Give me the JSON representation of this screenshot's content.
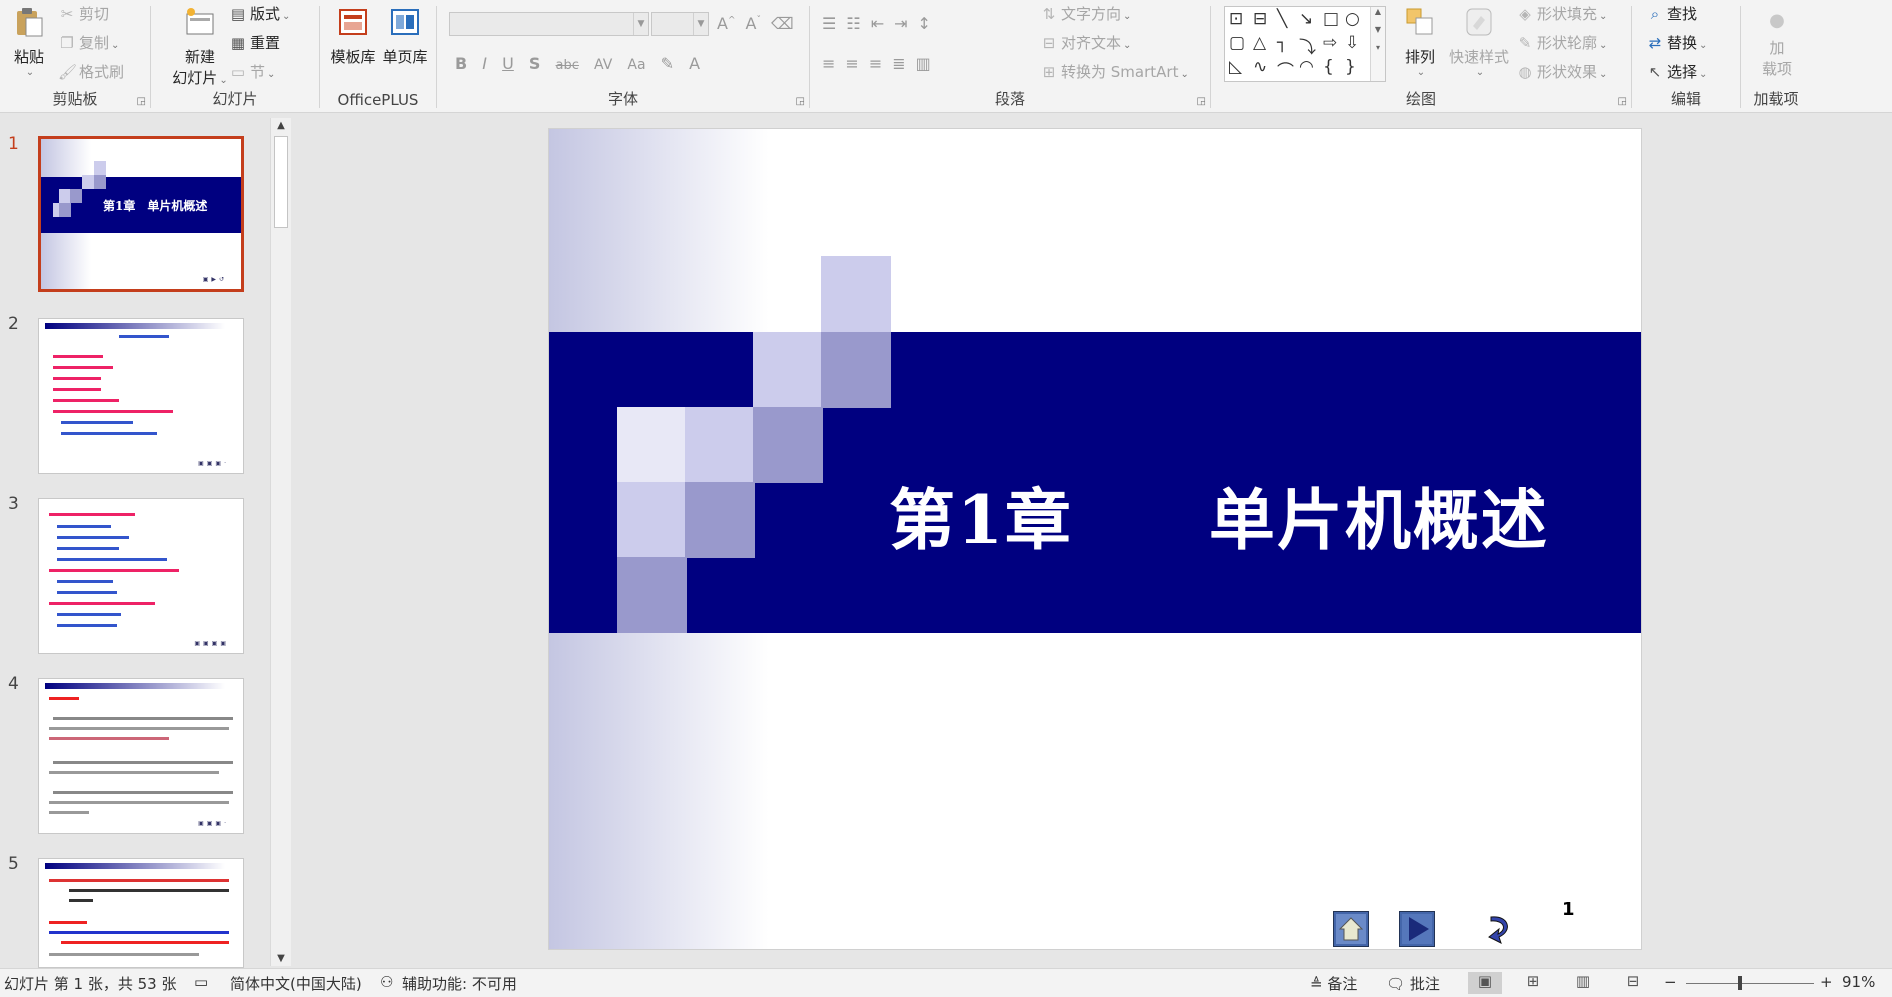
{
  "ribbon": {
    "clipboard": {
      "label": "剪贴板",
      "paste": "粘贴",
      "cut": "剪切",
      "copy": "复制",
      "format_painter": "格式刷"
    },
    "slides": {
      "label": "幻灯片",
      "new_slide": "新建\n幻灯片",
      "new_slide_line1": "新建",
      "new_slide_line2": "幻灯片",
      "layout": "版式",
      "reset": "重置",
      "section": "节"
    },
    "officeplus": {
      "label": "OfficePLUS",
      "template_library": "模板库",
      "single_page_library": "单页库"
    },
    "font": {
      "label": "字体",
      "font_name_value": "",
      "font_size_value": "",
      "bold": "B",
      "italic": "I",
      "underline": "U",
      "shadow": "S",
      "strike": "abc",
      "spacing": "AV",
      "case": "Aa"
    },
    "paragraph": {
      "label": "段落",
      "text_direction": "文字方向",
      "align_text": "对齐文本",
      "convert_smartart": "转换为 SmartArt"
    },
    "drawing": {
      "label": "绘图",
      "arrange": "排列",
      "quick_styles": "快速样式",
      "shape_fill": "形状填充",
      "shape_outline": "形状轮廓",
      "shape_effects": "形状效果"
    },
    "editing": {
      "label": "编辑",
      "find": "查找",
      "replace": "替换",
      "select": "选择"
    },
    "addins": {
      "label": "加载项",
      "addin_line1": "加",
      "addin_line2": "载项"
    }
  },
  "thumbnails": {
    "items": [
      {
        "number": "1",
        "title": "第1章　单片机概述"
      },
      {
        "number": "2"
      },
      {
        "number": "3"
      },
      {
        "number": "4"
      },
      {
        "number": "5"
      }
    ]
  },
  "slide": {
    "title": "第1章　　单片机概述",
    "page_number": "1",
    "colors": {
      "band": "#000080",
      "square_light": "#ccccec",
      "square_mid": "#9999cc",
      "square_dark": "#6666b3"
    }
  },
  "status": {
    "slide_info": "幻灯片 第 1 张，共 53 张",
    "language": "简体中文(中国大陆)",
    "accessibility": "辅助功能: 不可用",
    "notes": "备注",
    "comments": "批注",
    "zoom": "91%"
  }
}
